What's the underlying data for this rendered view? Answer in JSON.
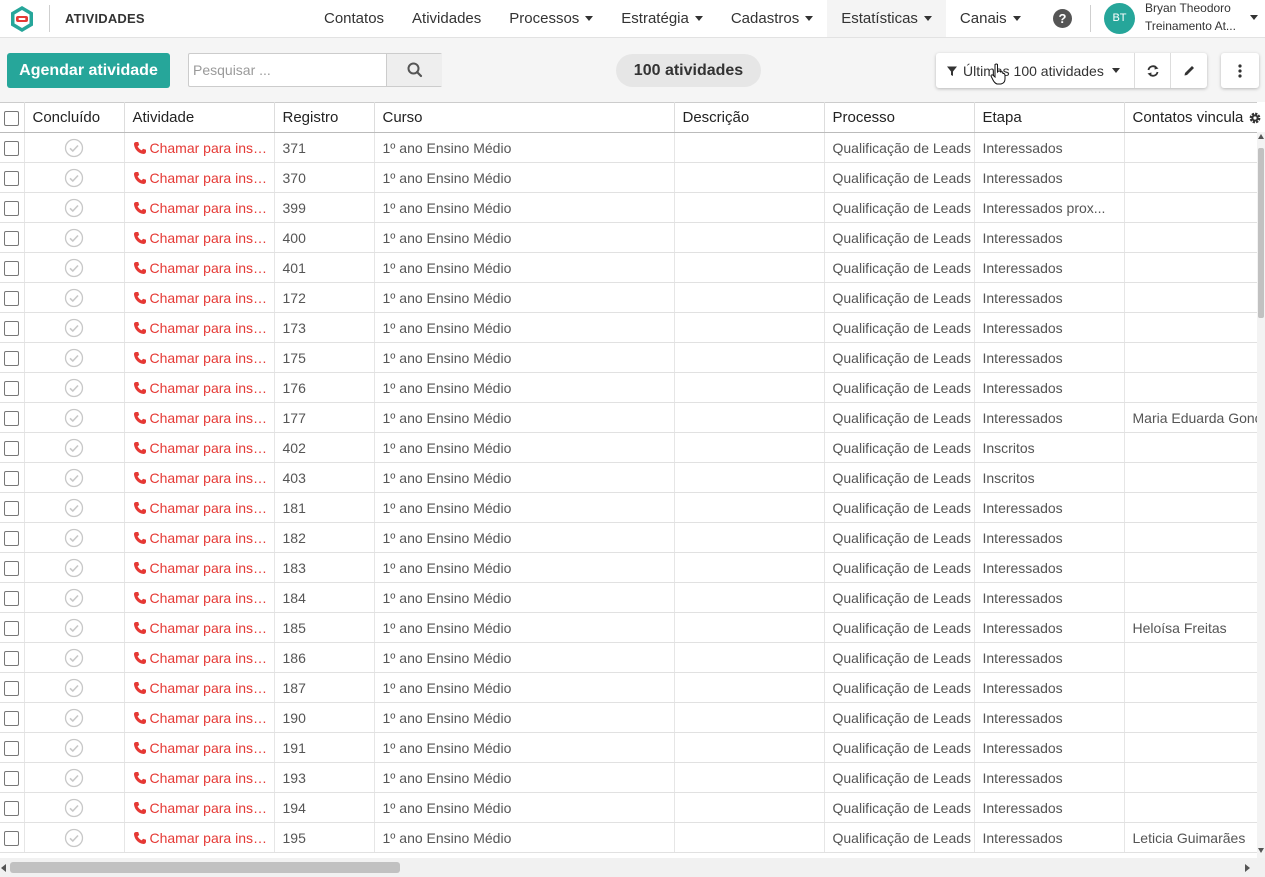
{
  "header": {
    "page_title": "ATIVIDADES",
    "nav": [
      {
        "label": "Contatos",
        "dropdown": false
      },
      {
        "label": "Atividades",
        "dropdown": false
      },
      {
        "label": "Processos",
        "dropdown": true
      },
      {
        "label": "Estratégia",
        "dropdown": true
      },
      {
        "label": "Cadastros",
        "dropdown": true
      },
      {
        "label": "Estatísticas",
        "dropdown": true
      },
      {
        "label": "Canais",
        "dropdown": true
      }
    ],
    "help_label": "?",
    "user": {
      "initials": "BT",
      "name": "Bryan Theodoro",
      "org": "Treinamento At..."
    }
  },
  "toolbar": {
    "schedule_button": "Agendar atividade",
    "search_placeholder": "Pesquisar ...",
    "count_label": "100 atividades",
    "filter_label": "Últimas 100 atividades"
  },
  "colors": {
    "accent": "#26a69a",
    "activity_red": "#e53935"
  },
  "table": {
    "columns": [
      "Concluído",
      "Atividade",
      "Registro",
      "Curso",
      "Descrição",
      "Processo",
      "Etapa",
      "Contatos vinculados"
    ],
    "rows": [
      {
        "atividade": "Chamar para inscrição",
        "registro": "371",
        "curso": "1º ano Ensino Médio",
        "descricao": "",
        "processo": "Qualificação de Leads",
        "etapa": "Interessados",
        "contato": ""
      },
      {
        "atividade": "Chamar para inscrição",
        "registro": "370",
        "curso": "1º ano Ensino Médio",
        "descricao": "",
        "processo": "Qualificação de Leads",
        "etapa": "Interessados",
        "contato": ""
      },
      {
        "atividade": "Chamar para inscrição",
        "registro": "399",
        "curso": "1º ano Ensino Médio",
        "descricao": "",
        "processo": "Qualificação de Leads",
        "etapa": "Interessados prox...",
        "contato": ""
      },
      {
        "atividade": "Chamar para inscrição",
        "registro": "400",
        "curso": "1º ano Ensino Médio",
        "descricao": "",
        "processo": "Qualificação de Leads",
        "etapa": "Interessados",
        "contato": ""
      },
      {
        "atividade": "Chamar para inscrição",
        "registro": "401",
        "curso": "1º ano Ensino Médio",
        "descricao": "",
        "processo": "Qualificação de Leads",
        "etapa": "Interessados",
        "contato": ""
      },
      {
        "atividade": "Chamar para inscrição",
        "registro": "172",
        "curso": "1º ano Ensino Médio",
        "descricao": "",
        "processo": "Qualificação de Leads",
        "etapa": "Interessados",
        "contato": ""
      },
      {
        "atividade": "Chamar para inscrição",
        "registro": "173",
        "curso": "1º ano Ensino Médio",
        "descricao": "",
        "processo": "Qualificação de Leads",
        "etapa": "Interessados",
        "contato": ""
      },
      {
        "atividade": "Chamar para inscrição",
        "registro": "175",
        "curso": "1º ano Ensino Médio",
        "descricao": "",
        "processo": "Qualificação de Leads",
        "etapa": "Interessados",
        "contato": ""
      },
      {
        "atividade": "Chamar para inscrição",
        "registro": "176",
        "curso": "1º ano Ensino Médio",
        "descricao": "",
        "processo": "Qualificação de Leads",
        "etapa": "Interessados",
        "contato": ""
      },
      {
        "atividade": "Chamar para inscrição",
        "registro": "177",
        "curso": "1º ano Ensino Médio",
        "descricao": "",
        "processo": "Qualificação de Leads",
        "etapa": "Interessados",
        "contato": "Maria Eduarda Gonç"
      },
      {
        "atividade": "Chamar para inscrição",
        "registro": "402",
        "curso": "1º ano Ensino Médio",
        "descricao": "",
        "processo": "Qualificação de Leads",
        "etapa": "Inscritos",
        "contato": ""
      },
      {
        "atividade": "Chamar para inscrição",
        "registro": "403",
        "curso": "1º ano Ensino Médio",
        "descricao": "",
        "processo": "Qualificação de Leads",
        "etapa": "Inscritos",
        "contato": ""
      },
      {
        "atividade": "Chamar para inscrição",
        "registro": "181",
        "curso": "1º ano Ensino Médio",
        "descricao": "",
        "processo": "Qualificação de Leads",
        "etapa": "Interessados",
        "contato": ""
      },
      {
        "atividade": "Chamar para inscrição",
        "registro": "182",
        "curso": "1º ano Ensino Médio",
        "descricao": "",
        "processo": "Qualificação de Leads",
        "etapa": "Interessados",
        "contato": ""
      },
      {
        "atividade": "Chamar para inscrição",
        "registro": "183",
        "curso": "1º ano Ensino Médio",
        "descricao": "",
        "processo": "Qualificação de Leads",
        "etapa": "Interessados",
        "contato": ""
      },
      {
        "atividade": "Chamar para inscrição",
        "registro": "184",
        "curso": "1º ano Ensino Médio",
        "descricao": "",
        "processo": "Qualificação de Leads",
        "etapa": "Interessados",
        "contato": ""
      },
      {
        "atividade": "Chamar para inscrição",
        "registro": "185",
        "curso": "1º ano Ensino Médio",
        "descricao": "",
        "processo": "Qualificação de Leads",
        "etapa": "Interessados",
        "contato": "Heloísa Freitas"
      },
      {
        "atividade": "Chamar para inscrição",
        "registro": "186",
        "curso": "1º ano Ensino Médio",
        "descricao": "",
        "processo": "Qualificação de Leads",
        "etapa": "Interessados",
        "contato": ""
      },
      {
        "atividade": "Chamar para inscrição",
        "registro": "187",
        "curso": "1º ano Ensino Médio",
        "descricao": "",
        "processo": "Qualificação de Leads",
        "etapa": "Interessados",
        "contato": ""
      },
      {
        "atividade": "Chamar para inscrição",
        "registro": "190",
        "curso": "1º ano Ensino Médio",
        "descricao": "",
        "processo": "Qualificação de Leads",
        "etapa": "Interessados",
        "contato": ""
      },
      {
        "atividade": "Chamar para inscrição",
        "registro": "191",
        "curso": "1º ano Ensino Médio",
        "descricao": "",
        "processo": "Qualificação de Leads",
        "etapa": "Interessados",
        "contato": ""
      },
      {
        "atividade": "Chamar para inscrição",
        "registro": "193",
        "curso": "1º ano Ensino Médio",
        "descricao": "",
        "processo": "Qualificação de Leads",
        "etapa": "Interessados",
        "contato": ""
      },
      {
        "atividade": "Chamar para inscrição",
        "registro": "194",
        "curso": "1º ano Ensino Médio",
        "descricao": "",
        "processo": "Qualificação de Leads",
        "etapa": "Interessados",
        "contato": ""
      },
      {
        "atividade": "Chamar para inscrição",
        "registro": "195",
        "curso": "1º ano Ensino Médio",
        "descricao": "",
        "processo": "Qualificação de Leads",
        "etapa": "Interessados",
        "contato": "Leticia Guimarães"
      }
    ]
  }
}
